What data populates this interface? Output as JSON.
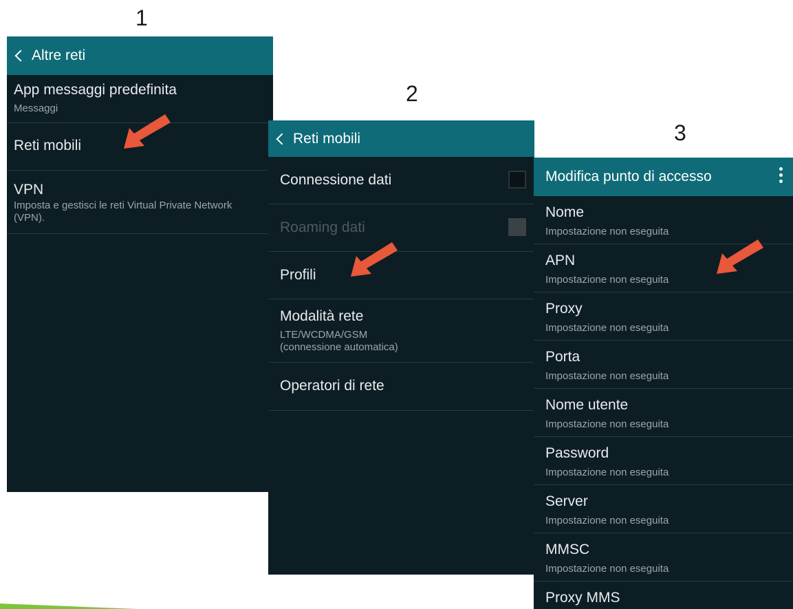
{
  "steps": [
    "1",
    "2",
    "3"
  ],
  "panel1": {
    "title": "Altre reti",
    "items": [
      {
        "title": "App messaggi predefinita",
        "sub": "Messaggi"
      },
      {
        "title": "Reti mobili",
        "sub": ""
      },
      {
        "title": "VPN",
        "sub": "Imposta e gestisci le reti Virtual Private Network (VPN)."
      }
    ]
  },
  "panel2": {
    "title": "Reti mobili",
    "items": [
      {
        "title": "Connessione dati",
        "checkbox": "unchecked"
      },
      {
        "title": "Roaming dati",
        "checkbox": "disabled"
      },
      {
        "title": "Profili"
      },
      {
        "title": "Modalità rete",
        "sub_line1": "LTE/WCDMA/GSM",
        "sub_line2": "(connessione automatica)"
      },
      {
        "title": "Operatori di rete"
      }
    ]
  },
  "panel3": {
    "title": "Modifica punto di accesso",
    "items": [
      {
        "title": "Nome",
        "sub": "Impostazione non eseguita"
      },
      {
        "title": "APN",
        "sub": "Impostazione non eseguita"
      },
      {
        "title": "Proxy",
        "sub": "Impostazione non eseguita"
      },
      {
        "title": "Porta",
        "sub": "Impostazione non eseguita"
      },
      {
        "title": "Nome utente",
        "sub": "Impostazione non eseguita"
      },
      {
        "title": "Password",
        "sub": "Impostazione non eseguita"
      },
      {
        "title": "Server",
        "sub": "Impostazione non eseguita"
      },
      {
        "title": "MMSC",
        "sub": "Impostazione non eseguita"
      },
      {
        "title": "Proxy MMS",
        "sub": ""
      }
    ]
  },
  "colors": {
    "titlebar": "#0f6b78",
    "panel_bg": "#0d1d24",
    "arrow": "#e8583a",
    "swoosh": "#7dc43a"
  },
  "icons": [
    "back-chevron-icon",
    "overflow-menu-icon",
    "pointer-arrow-icon"
  ]
}
